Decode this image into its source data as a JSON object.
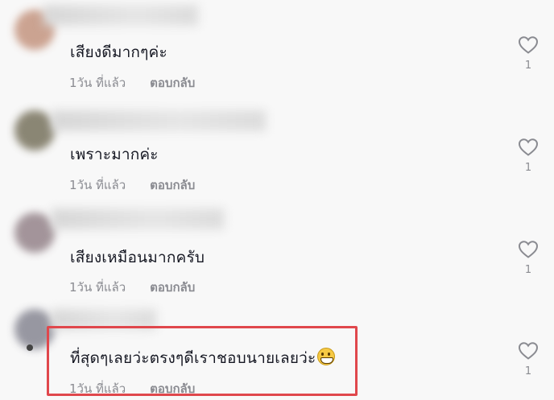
{
  "comments": [
    {
      "text": "เสียงดีมากๆค่ะ",
      "time": "1วัน ที่แล้ว",
      "reply": "ตอบกลับ",
      "likes": "1",
      "avatar_color": "#c79a86"
    },
    {
      "text": "เพราะมากค่ะ",
      "time": "1วัน ที่แล้ว",
      "reply": "ตอบกลับ",
      "likes": "1",
      "avatar_color": "#7f7a66"
    },
    {
      "text": "เสียงเหมือนมากครับ",
      "time": "1วัน ที่แล้ว",
      "reply": "ตอบกลับ",
      "likes": "1",
      "avatar_color": "#9a8a90"
    },
    {
      "text": "ที่สุดๆเลยว่ะตรงๆดีเราชอบนายเลยว่ะ",
      "emoji": "grinning-face-icon",
      "time": "1วัน ที่แล้ว",
      "reply": "ตอบกลับ",
      "likes": "1",
      "avatar_color": "#8d8d98"
    }
  ],
  "highlight_color": "#e0474c",
  "icons": {
    "like": "heart-outline-icon"
  }
}
